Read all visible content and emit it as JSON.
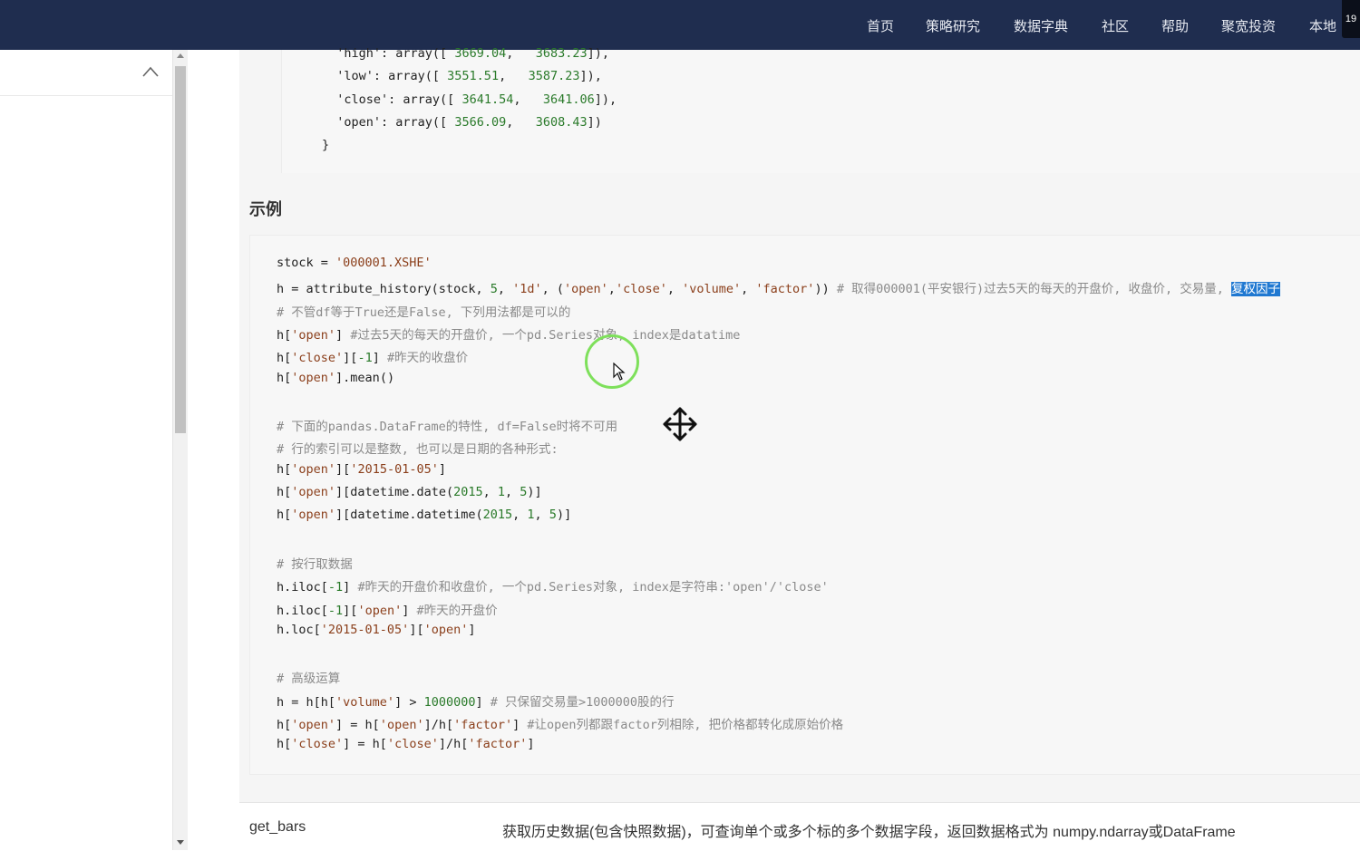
{
  "nav": {
    "items": [
      "首页",
      "策略研究",
      "数据字典",
      "社区",
      "帮助",
      "聚宽投资",
      "本地"
    ],
    "corner_badge": "19"
  },
  "code_top": {
    "lines": [
      [
        [
          "  'high': array([ ",
          ""
        ],
        [
          "3669.04",
          "num"
        ],
        [
          ",   ",
          ""
        ],
        [
          "3683.23",
          "num"
        ],
        [
          "]),",
          ""
        ]
      ],
      [
        [
          "  'low': array([ ",
          ""
        ],
        [
          "3551.51",
          "num"
        ],
        [
          ",   ",
          ""
        ],
        [
          "3587.23",
          "num"
        ],
        [
          "]),",
          ""
        ]
      ],
      [
        [
          "  'close': array([ ",
          ""
        ],
        [
          "3641.54",
          "num"
        ],
        [
          ",   ",
          ""
        ],
        [
          "3641.06",
          "num"
        ],
        [
          "]),",
          ""
        ]
      ],
      [
        [
          "  'open': array([ ",
          ""
        ],
        [
          "3566.09",
          "num"
        ],
        [
          ",   ",
          ""
        ],
        [
          "3608.43",
          "num"
        ],
        [
          "])",
          ""
        ]
      ],
      [
        [
          "}",
          ""
        ]
      ]
    ]
  },
  "section_title": "示例",
  "code_example": {
    "lines": [
      [
        [
          "stock = ",
          ""
        ],
        [
          "'000001.XSHE'",
          "str"
        ]
      ],
      [
        [
          "h = attribute_history(stock, ",
          ""
        ],
        [
          "5",
          "num"
        ],
        [
          ", ",
          ""
        ],
        [
          "'1d'",
          "str"
        ],
        [
          ", (",
          ""
        ],
        [
          "'open'",
          "str"
        ],
        [
          ",",
          ""
        ],
        [
          "'close'",
          "str"
        ],
        [
          ", ",
          ""
        ],
        [
          "'volume'",
          "str"
        ],
        [
          ", ",
          ""
        ],
        [
          "'factor'",
          "str"
        ],
        [
          ")) ",
          ""
        ],
        [
          "# 取得000001(平安银行)过去5天的每天的开盘价, 收盘价, 交易量, ",
          "cmt"
        ],
        [
          "复权因子",
          "hl"
        ]
      ],
      [
        [
          "# 不管df等于True还是False, 下列用法都是可以的",
          "cmt"
        ]
      ],
      [
        [
          "h[",
          ""
        ],
        [
          "'open'",
          "str"
        ],
        [
          "] ",
          ""
        ],
        [
          "#过去5天的每天的开盘价, 一个pd.Series对象, index是datatime",
          "cmt"
        ]
      ],
      [
        [
          "h[",
          ""
        ],
        [
          "'close'",
          "str"
        ],
        [
          "][",
          ""
        ],
        [
          "-1",
          "num"
        ],
        [
          "] ",
          ""
        ],
        [
          "#昨天的收盘价",
          "cmt"
        ]
      ],
      [
        [
          "h[",
          ""
        ],
        [
          "'open'",
          "str"
        ],
        [
          "].mean()",
          ""
        ]
      ],
      [],
      [
        [
          "# 下面的pandas.DataFrame的特性, df=False时将不可用",
          "cmt"
        ]
      ],
      [
        [
          "# 行的索引可以是整数, 也可以是日期的各种形式:",
          "cmt"
        ]
      ],
      [
        [
          "h[",
          ""
        ],
        [
          "'open'",
          "str"
        ],
        [
          "][",
          ""
        ],
        [
          "'2015-01-05'",
          "str"
        ],
        [
          "]",
          ""
        ]
      ],
      [
        [
          "h[",
          ""
        ],
        [
          "'open'",
          "str"
        ],
        [
          "][datetime.date(",
          ""
        ],
        [
          "2015",
          "num"
        ],
        [
          ", ",
          ""
        ],
        [
          "1",
          "num"
        ],
        [
          ", ",
          ""
        ],
        [
          "5",
          "num"
        ],
        [
          ")]",
          ""
        ]
      ],
      [
        [
          "h[",
          ""
        ],
        [
          "'open'",
          "str"
        ],
        [
          "][datetime.datetime(",
          ""
        ],
        [
          "2015",
          "num"
        ],
        [
          ", ",
          ""
        ],
        [
          "1",
          "num"
        ],
        [
          ", ",
          ""
        ],
        [
          "5",
          "num"
        ],
        [
          ")]",
          ""
        ]
      ],
      [],
      [
        [
          "# 按行取数据",
          "cmt"
        ]
      ],
      [
        [
          "h.iloc[",
          ""
        ],
        [
          "-1",
          "num"
        ],
        [
          "] ",
          ""
        ],
        [
          "#昨天的开盘价和收盘价, 一个pd.Series对象, index是字符串:'open'/'close'",
          "cmt"
        ]
      ],
      [
        [
          "h.iloc[",
          ""
        ],
        [
          "-1",
          "num"
        ],
        [
          "][",
          ""
        ],
        [
          "'open'",
          "str"
        ],
        [
          "] ",
          ""
        ],
        [
          "#昨天的开盘价",
          "cmt"
        ]
      ],
      [
        [
          "h.loc[",
          ""
        ],
        [
          "'2015-01-05'",
          "str"
        ],
        [
          "][",
          ""
        ],
        [
          "'open'",
          "str"
        ],
        [
          "]",
          ""
        ]
      ],
      [],
      [
        [
          "# 高级运算",
          "cmt"
        ]
      ],
      [
        [
          "h = h[h[",
          ""
        ],
        [
          "'volume'",
          "str"
        ],
        [
          "] > ",
          ""
        ],
        [
          "1000000",
          "num"
        ],
        [
          "] ",
          ""
        ],
        [
          "# 只保留交易量>1000000股的行",
          "cmt"
        ]
      ],
      [
        [
          "h[",
          ""
        ],
        [
          "'open'",
          "str"
        ],
        [
          "] = h[",
          ""
        ],
        [
          "'open'",
          "str"
        ],
        [
          "]/h[",
          ""
        ],
        [
          "'factor'",
          "str"
        ],
        [
          "] ",
          ""
        ],
        [
          "#让open列都跟factor列相除, 把价格都转化成原始价格",
          "cmt"
        ]
      ],
      [
        [
          "h[",
          ""
        ],
        [
          "'close'",
          "str"
        ],
        [
          "] = h[",
          ""
        ],
        [
          "'close'",
          "str"
        ],
        [
          "]/h[",
          ""
        ],
        [
          "'factor'",
          "str"
        ],
        [
          "]",
          ""
        ]
      ]
    ]
  },
  "function_row": {
    "name": "get_bars",
    "description": "获取历史数据(包含快照数据)，可查询单个或多个标的多个数据字段，返回数据格式为 numpy.ndarray或DataFrame"
  },
  "colors": {
    "topbar": "#1f2d4f",
    "string": "#8b3f1b",
    "number": "#2a7a2a",
    "comment": "#8a8a8a",
    "highlight": "#1f78d1",
    "cursor_ring": "#7ee05b"
  },
  "icons": [
    "chevron-up-icon",
    "move-icon",
    "mouse-pointer-icon"
  ]
}
